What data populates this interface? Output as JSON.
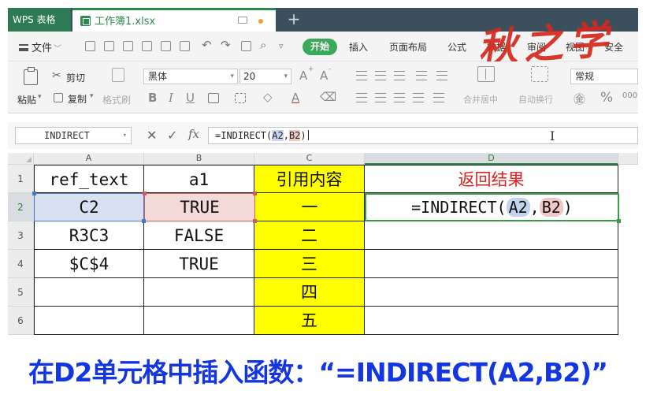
{
  "titlebar": {
    "app_name": "WPS 表格",
    "doc_tab": "工作簿1.xlsx",
    "new_tab": "+"
  },
  "menubar": {
    "file": "文件",
    "tabs": [
      "开始",
      "插入",
      "页面布局",
      "公式",
      "数据",
      "审阅",
      "视图",
      "安全"
    ],
    "active_tab": "开始"
  },
  "watermark": "秋之学",
  "ribbon": {
    "paste": "粘贴",
    "cut": "剪切",
    "copy": "复制",
    "format_painter": "格式刷",
    "font_name": "黑体",
    "font_size": "20",
    "grow_font": "A",
    "shrink_font": "A",
    "bold": "B",
    "italic": "I",
    "underline": "U",
    "merge_center": "合并居中",
    "wrap_text": "自动换行",
    "number_format": "常规",
    "percent": "%"
  },
  "formula_bar": {
    "name_box": "INDIRECT",
    "cancel": "✕",
    "confirm": "✓",
    "fx": "fx",
    "formula_prefix": "=INDIRECT(",
    "ref_a": "A2",
    "sep": ",",
    "ref_b": "B2",
    "formula_suffix": ")"
  },
  "grid": {
    "columns": [
      "A",
      "B",
      "C",
      "D"
    ],
    "active_column": "D",
    "rows": [
      "1",
      "2",
      "3",
      "4",
      "5",
      "6"
    ],
    "active_row": "2",
    "cells": {
      "A1": "ref_text",
      "B1": "a1",
      "C1": "引用内容",
      "D1": "返回结果",
      "A2": "C2",
      "B2": "TRUE",
      "C2": "一",
      "A3": "R3C3",
      "B3": "FALSE",
      "C3": "二",
      "A4": "$C$4",
      "B4": "TRUE",
      "C4": "三",
      "C5": "四",
      "C6": "五"
    },
    "editing_cell": {
      "prefix": "=INDIRECT(",
      "ref_a": "A2",
      "sep": ",",
      "ref_b": "B2",
      "suffix": ")"
    }
  },
  "caption": "在D2单元格中插入函数：“=INDIRECT(A2,B2)”",
  "colors": {
    "wps_green": "#2d8a4e",
    "highlight_yellow": "#ffff00",
    "result_red": "#e02020",
    "caption_blue": "#1436e0"
  }
}
